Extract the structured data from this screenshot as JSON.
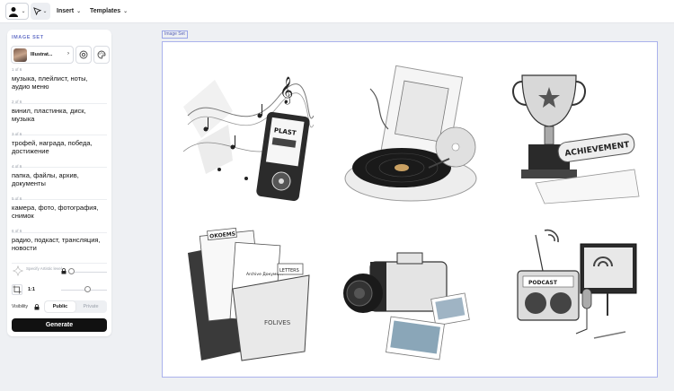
{
  "topbar": {
    "insert_label": "Insert",
    "templates_label": "Templates"
  },
  "panel": {
    "title": "IMAGE SET",
    "style_name": "Illustrat...",
    "prompts": [
      {
        "index": "1 of 6",
        "text": "музыка, плейлист, ноты, аудио меню"
      },
      {
        "index": "2 of 6",
        "text": "винил, пластинка, диск, музыка"
      },
      {
        "index": "3 of 6",
        "text": "трофей, награда, победа, достижение"
      },
      {
        "index": "4 of 6",
        "text": "папка, файлы, архив, документы"
      },
      {
        "index": "5 of 6",
        "text": "камера, фото, фотография, снимок"
      },
      {
        "index": "6 of 6",
        "text": "радио, подкаст, трансляция, новости"
      }
    ],
    "artistic_label": "Specify Artistic level",
    "ratio_label": "1:1",
    "visibility_label": "Visibility",
    "public_label": "Public",
    "private_label": "Private",
    "generate_label": "Generate"
  },
  "canvas": {
    "frame_label": "Image Set",
    "image_texts": {
      "player": "PLAST",
      "trophy": "ACHIEVEMENT",
      "folder_tab": "OKOEMS",
      "folder_doc": "Archive Документ",
      "folder_doc2": "LETTERS",
      "folder": "FOLIVES",
      "radio": "PODCAST"
    }
  },
  "colors": {
    "accent": "#6a75c9",
    "frame_border": "#aab2ec",
    "button_dark": "#111111",
    "background": "#eef0f3"
  }
}
